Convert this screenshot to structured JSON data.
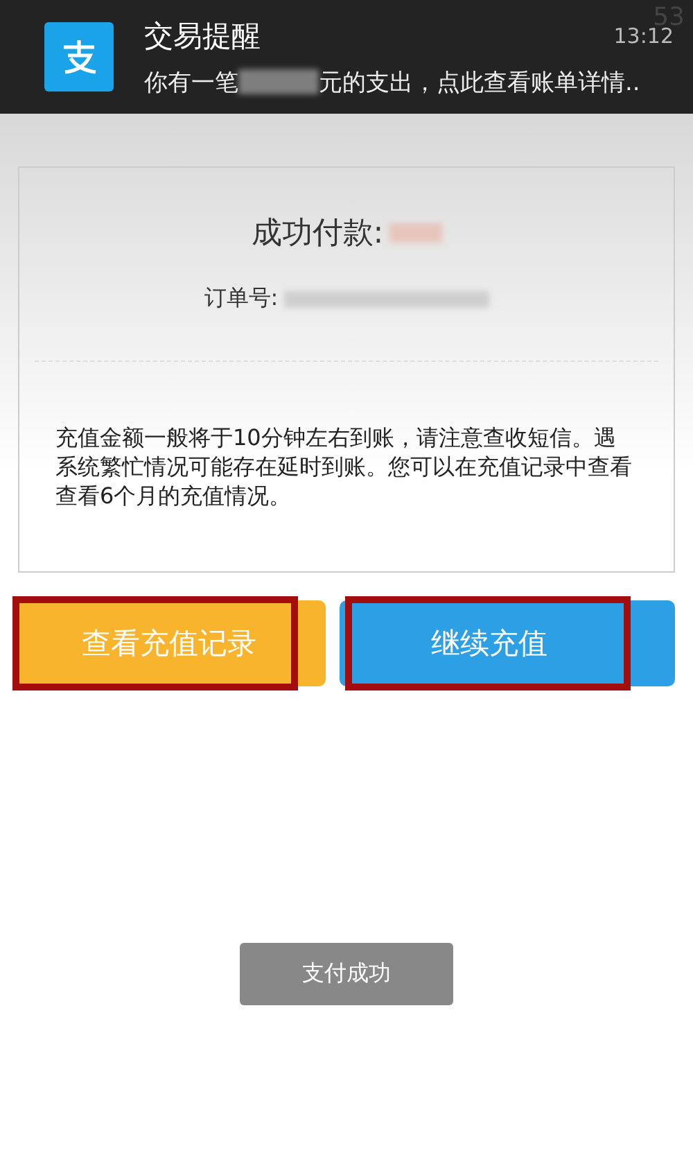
{
  "status_bar": {
    "battery": "53"
  },
  "notification": {
    "title": "交易提醒",
    "time": "13:12",
    "message_before": "你有一笔",
    "message_after": "元的支出，点此查看账单详情.."
  },
  "result_card": {
    "amount_label": "成功付款:",
    "order_label": "订单号:",
    "note": "充值金额一般将于10分钟左右到账，请注意查收短信。遇系统繁忙情况可能存在延时到账。您可以在充值记录中查看查看6个月的充值情况。"
  },
  "buttons": [
    {
      "label": "查看充值记录",
      "kind": "secondary",
      "highlighted": true
    },
    {
      "label": "继续充值",
      "kind": "primary",
      "highlighted": true
    }
  ],
  "toast": {
    "text": "支付成功"
  }
}
